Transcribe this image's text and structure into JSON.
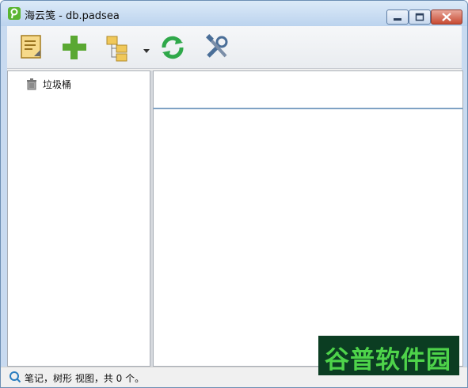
{
  "window": {
    "title": "海云笺 - db.padsea"
  },
  "toolbar": {
    "buttons": [
      {
        "icon": "note-icon"
      },
      {
        "icon": "add-icon"
      },
      {
        "icon": "tree-view-icon",
        "has_dropdown": true
      },
      {
        "icon": "refresh-icon"
      },
      {
        "icon": "tools-icon"
      }
    ]
  },
  "tree": {
    "items": [
      {
        "label": "垃圾桶",
        "icon": "trash-icon"
      }
    ]
  },
  "statusbar": {
    "text": "笔记，树形 视图，共 0 个。"
  },
  "watermark": {
    "text": "谷普软件园"
  },
  "colors": {
    "title_bg": "#c8daf0",
    "close_button": "#c84a32",
    "add_green": "#5aa832",
    "watermark_bg": "#0b3d22",
    "watermark_text": "#4ed34a"
  }
}
